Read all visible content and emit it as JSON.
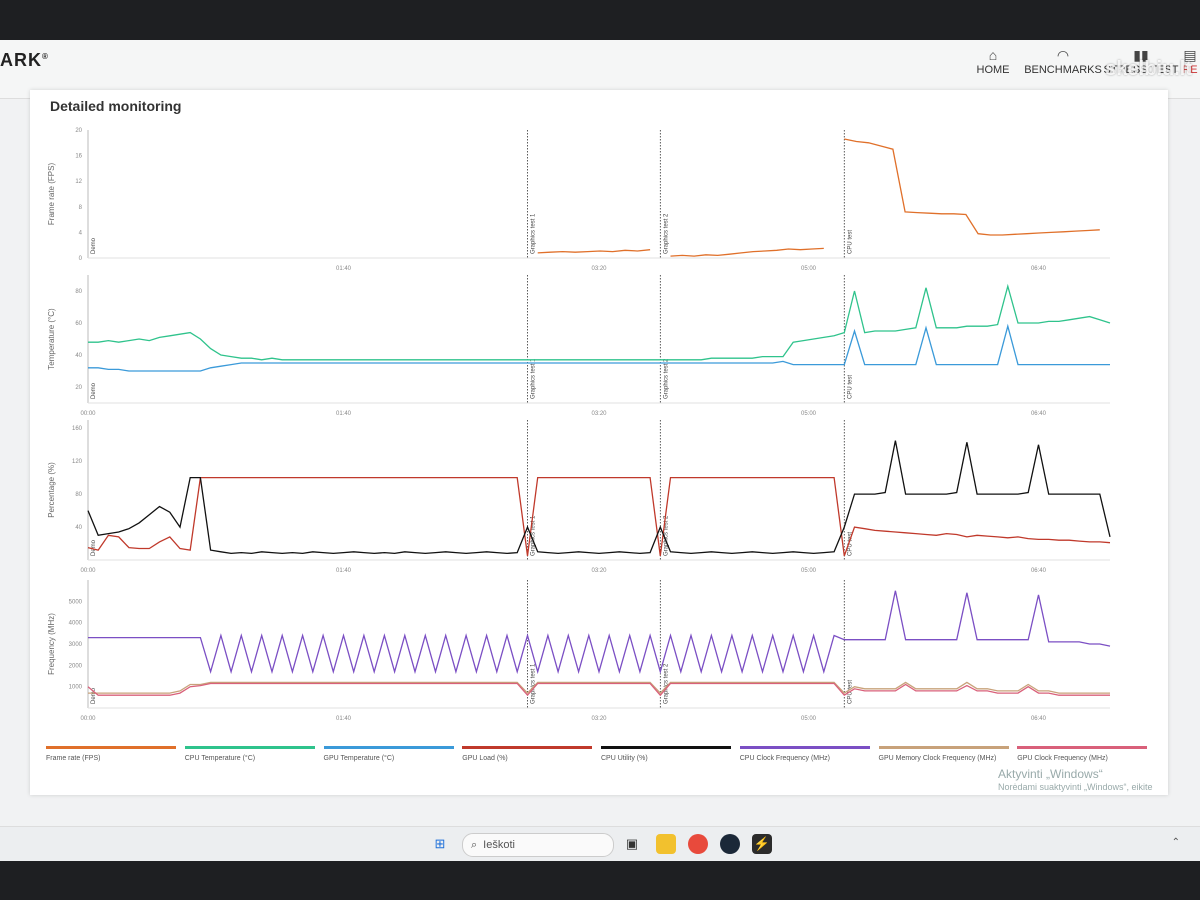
{
  "header": {
    "brand": "ARK",
    "nav": [
      {
        "label": "HOME",
        "icon": "home-icon"
      },
      {
        "label": "BENCHMARKS",
        "icon": "speedometer-icon"
      },
      {
        "label": "STRESS TEST",
        "icon": "chart-icon"
      },
      {
        "label": "RE",
        "icon": "results-icon"
      }
    ],
    "watermark": "skelbiu.lt"
  },
  "panel": {
    "title": "Detailed monitoring"
  },
  "colors": {
    "frame_rate": "#e0702a",
    "cpu_temp": "#2fc38c",
    "gpu_temp": "#3b9ad9",
    "gpu_load": "#c0392b",
    "cpu_utility": "#111111",
    "cpu_clock": "#7b4fc4",
    "gpu_mem_clock": "#c8a27a",
    "gpu_clock": "#d9607a"
  },
  "chart_data": [
    {
      "type": "line",
      "ylabel": "Frame rate (FPS)",
      "yticks": [
        "0",
        "4",
        "8",
        "12",
        "16",
        "20"
      ],
      "ylim": [
        0,
        20
      ],
      "xticks": [
        "01:40",
        "03:20",
        "05:00",
        "06:40"
      ],
      "markers": [
        {
          "label": "Demo",
          "t": 0
        },
        {
          "label": "Graphics test 1",
          "t": 0.43
        },
        {
          "label": "Graphics test 2",
          "t": 0.56
        },
        {
          "label": "CPU test",
          "t": 0.74
        }
      ],
      "series": [
        {
          "name": "Frame rate (FPS)",
          "color_key": "frame_rate",
          "segments": [
            {
              "t0": 0.44,
              "t1": 0.55,
              "values": [
                0.8,
                0.9,
                1.0,
                0.9,
                1.0,
                1.1,
                1.0,
                1.2,
                1.1,
                1.3
              ]
            },
            {
              "t0": 0.57,
              "t1": 0.72,
              "values": [
                0.3,
                0.4,
                0.3,
                0.5,
                0.4,
                0.6,
                0.8,
                1.0,
                1.1,
                1.2,
                1.4,
                1.3,
                1.4,
                1.5
              ]
            },
            {
              "t0": 0.74,
              "t1": 0.99,
              "values": [
                18.6,
                18.2,
                18.0,
                17.5,
                17.0,
                7.2,
                7.1,
                7.0,
                6.9,
                6.9,
                6.8,
                3.8,
                3.6,
                3.6,
                3.7,
                3.8,
                3.9,
                4.0,
                4.1,
                4.2,
                4.3,
                4.4
              ]
            }
          ]
        }
      ]
    },
    {
      "type": "line",
      "ylabel": "Temperature (°C)",
      "yticks": [
        "20",
        "40",
        "60",
        "80"
      ],
      "ylim": [
        10,
        90
      ],
      "xticks": [
        "00:00",
        "01:40",
        "03:20",
        "05:00",
        "06:40"
      ],
      "markers": [
        {
          "label": "Demo",
          "t": 0
        },
        {
          "label": "Graphics test 1",
          "t": 0.43
        },
        {
          "label": "Graphics test 2",
          "t": 0.56
        },
        {
          "label": "CPU test",
          "t": 0.74
        }
      ],
      "series": [
        {
          "name": "CPU Temperature (°C)",
          "color_key": "cpu_temp",
          "values": [
            48,
            48,
            49,
            48,
            49,
            50,
            49,
            51,
            52,
            53,
            54,
            50,
            44,
            40,
            39,
            38,
            38,
            37,
            38,
            37,
            37,
            37,
            37,
            37,
            37,
            37,
            37,
            37,
            37,
            37,
            37,
            37,
            37,
            37,
            37,
            37,
            37,
            37,
            37,
            37,
            37,
            37,
            37,
            37,
            37,
            37,
            37,
            37,
            37,
            37,
            37,
            37,
            37,
            37,
            37,
            37,
            37,
            37,
            37,
            37,
            37,
            38,
            38,
            38,
            38,
            38,
            39,
            39,
            39,
            48,
            49,
            50,
            51,
            52,
            54,
            80,
            54,
            55,
            55,
            55,
            56,
            57,
            82,
            57,
            57,
            57,
            58,
            58,
            58,
            59,
            83,
            60,
            60,
            60,
            61,
            61,
            62,
            63,
            64,
            62,
            60
          ]
        },
        {
          "name": "GPU Temperature (°C)",
          "color_key": "gpu_temp",
          "values": [
            32,
            32,
            31,
            31,
            30,
            30,
            30,
            30,
            30,
            30,
            30,
            30,
            32,
            33,
            34,
            35,
            35,
            35,
            35,
            35,
            35,
            35,
            35,
            35,
            35,
            35,
            35,
            35,
            35,
            35,
            35,
            35,
            35,
            35,
            35,
            35,
            35,
            35,
            35,
            35,
            35,
            35,
            35,
            35,
            35,
            35,
            35,
            35,
            35,
            35,
            35,
            35,
            35,
            35,
            35,
            35,
            35,
            35,
            35,
            35,
            35,
            35,
            35,
            35,
            35,
            35,
            35,
            35,
            36,
            34,
            34,
            34,
            34,
            34,
            34,
            55,
            34,
            34,
            34,
            34,
            34,
            34,
            57,
            34,
            34,
            34,
            34,
            34,
            34,
            34,
            58,
            34,
            34,
            34,
            34,
            34,
            34,
            34,
            34,
            34,
            34
          ]
        }
      ]
    },
    {
      "type": "line",
      "ylabel": "Percentage (%)",
      "yticks": [
        "40",
        "80",
        "120",
        "160"
      ],
      "ylim": [
        0,
        170
      ],
      "xticks": [
        "00:00",
        "01:40",
        "03:20",
        "05:00",
        "06:40"
      ],
      "markers": [
        {
          "label": "Demo",
          "t": 0
        },
        {
          "label": "Graphics test 1",
          "t": 0.43
        },
        {
          "label": "Graphics test 2",
          "t": 0.56
        },
        {
          "label": "CPU test",
          "t": 0.74
        }
      ],
      "series": [
        {
          "name": "GPU Load (%)",
          "color_key": "gpu_load",
          "values": [
            15,
            12,
            30,
            28,
            15,
            14,
            14,
            22,
            28,
            14,
            12,
            100,
            100,
            100,
            100,
            100,
            100,
            100,
            100,
            100,
            100,
            100,
            100,
            100,
            100,
            100,
            100,
            100,
            100,
            100,
            100,
            100,
            100,
            100,
            100,
            100,
            100,
            100,
            100,
            100,
            100,
            100,
            100,
            5,
            100,
            100,
            100,
            100,
            100,
            100,
            100,
            100,
            100,
            100,
            100,
            100,
            5,
            100,
            100,
            100,
            100,
            100,
            100,
            100,
            100,
            100,
            100,
            100,
            100,
            100,
            100,
            100,
            100,
            100,
            5,
            40,
            38,
            36,
            35,
            34,
            33,
            32,
            31,
            30,
            32,
            31,
            28,
            30,
            29,
            28,
            27,
            28,
            26,
            25,
            25,
            24,
            24,
            23,
            22,
            22,
            21
          ]
        },
        {
          "name": "CPU Utility (%)",
          "color_key": "cpu_utility",
          "values": [
            60,
            30,
            32,
            34,
            38,
            45,
            55,
            65,
            58,
            40,
            100,
            100,
            12,
            10,
            8,
            9,
            8,
            10,
            9,
            8,
            9,
            8,
            10,
            9,
            8,
            9,
            10,
            9,
            8,
            9,
            8,
            10,
            9,
            8,
            9,
            10,
            9,
            8,
            9,
            10,
            9,
            8,
            9,
            40,
            10,
            9,
            8,
            9,
            10,
            9,
            8,
            9,
            10,
            9,
            8,
            9,
            40,
            10,
            9,
            8,
            9,
            10,
            9,
            8,
            9,
            10,
            9,
            8,
            9,
            10,
            9,
            8,
            9,
            10,
            40,
            80,
            80,
            80,
            82,
            145,
            80,
            80,
            80,
            80,
            80,
            82,
            143,
            80,
            80,
            80,
            80,
            80,
            82,
            140,
            80,
            80,
            80,
            80,
            80,
            80,
            28
          ]
        }
      ]
    },
    {
      "type": "line",
      "ylabel": "Frequency (MHz)",
      "yticks": [
        "1000",
        "2000",
        "3000",
        "4000",
        "5000"
      ],
      "ylim": [
        0,
        6000
      ],
      "xticks": [
        "00:00",
        "01:40",
        "03:20",
        "05:00",
        "06:40"
      ],
      "markers": [
        {
          "label": "Demo",
          "t": 0
        },
        {
          "label": "Graphics test 1",
          "t": 0.43
        },
        {
          "label": "Graphics test 2",
          "t": 0.56
        },
        {
          "label": "CPU test",
          "t": 0.74
        }
      ],
      "series": [
        {
          "name": "CPU Clock Frequency (MHz)",
          "color_key": "cpu_clock",
          "values": [
            3300,
            3300,
            3300,
            3300,
            3300,
            3300,
            3300,
            3300,
            3300,
            3300,
            3300,
            3300,
            1700,
            3400,
            1700,
            3400,
            1700,
            3400,
            1700,
            3400,
            1700,
            3400,
            1700,
            3400,
            1700,
            3400,
            1700,
            3400,
            1700,
            3400,
            1700,
            3400,
            1700,
            3400,
            1700,
            3400,
            1700,
            3400,
            1700,
            3400,
            1700,
            3400,
            1700,
            3400,
            1700,
            3400,
            1700,
            3400,
            1700,
            3400,
            1700,
            3400,
            1700,
            3400,
            1700,
            3400,
            1700,
            3400,
            1700,
            3400,
            1700,
            3400,
            1700,
            3400,
            1700,
            3400,
            1700,
            3400,
            1700,
            3400,
            1700,
            3400,
            1700,
            3400,
            3200,
            3200,
            3200,
            3200,
            3200,
            5500,
            3200,
            3200,
            3200,
            3200,
            3200,
            3200,
            5400,
            3200,
            3200,
            3200,
            3200,
            3200,
            3200,
            5300,
            3100,
            3100,
            3100,
            3100,
            3000,
            3000,
            2900
          ]
        },
        {
          "name": "GPU Memory Clock Frequency (MHz)",
          "color_key": "gpu_mem_clock",
          "values": [
            700,
            700,
            700,
            700,
            700,
            700,
            700,
            700,
            700,
            800,
            1100,
            1100,
            1200,
            1200,
            1200,
            1200,
            1200,
            1200,
            1200,
            1200,
            1200,
            1200,
            1200,
            1200,
            1200,
            1200,
            1200,
            1200,
            1200,
            1200,
            1200,
            1200,
            1200,
            1200,
            1200,
            1200,
            1200,
            1200,
            1200,
            1200,
            1200,
            1200,
            1200,
            700,
            1200,
            1200,
            1200,
            1200,
            1200,
            1200,
            1200,
            1200,
            1200,
            1200,
            1200,
            1200,
            700,
            1200,
            1200,
            1200,
            1200,
            1200,
            1200,
            1200,
            1200,
            1200,
            1200,
            1200,
            1200,
            1200,
            1200,
            1200,
            1200,
            1200,
            700,
            1000,
            900,
            900,
            900,
            900,
            1200,
            900,
            900,
            900,
            900,
            900,
            1200,
            900,
            900,
            800,
            800,
            800,
            1100,
            800,
            800,
            700,
            700,
            700,
            700,
            700,
            700
          ]
        },
        {
          "name": "GPU Clock Frequency (MHz)",
          "color_key": "gpu_clock",
          "values": [
            1000,
            600,
            600,
            600,
            600,
            600,
            600,
            600,
            600,
            700,
            1000,
            1050,
            1150,
            1150,
            1150,
            1150,
            1150,
            1150,
            1150,
            1150,
            1150,
            1150,
            1150,
            1150,
            1150,
            1150,
            1150,
            1150,
            1150,
            1150,
            1150,
            1150,
            1150,
            1150,
            1150,
            1150,
            1150,
            1150,
            1150,
            1150,
            1150,
            1150,
            1150,
            600,
            1150,
            1150,
            1150,
            1150,
            1150,
            1150,
            1150,
            1150,
            1150,
            1150,
            1150,
            1150,
            600,
            1150,
            1150,
            1150,
            1150,
            1150,
            1150,
            1150,
            1150,
            1150,
            1150,
            1150,
            1150,
            1150,
            1150,
            1150,
            1150,
            1150,
            600,
            900,
            800,
            800,
            800,
            800,
            1100,
            800,
            800,
            800,
            800,
            800,
            1050,
            800,
            800,
            700,
            700,
            700,
            1000,
            700,
            700,
            600,
            600,
            600,
            600,
            600,
            600
          ]
        }
      ]
    }
  ],
  "legend": [
    {
      "label": "Frame rate (FPS)",
      "color_key": "frame_rate"
    },
    {
      "label": "CPU Temperature (°C)",
      "color_key": "cpu_temp"
    },
    {
      "label": "GPU Temperature (°C)",
      "color_key": "gpu_temp"
    },
    {
      "label": "GPU Load (%)",
      "color_key": "gpu_load"
    },
    {
      "label": "CPU Utility (%)",
      "color_key": "cpu_utility"
    },
    {
      "label": "CPU Clock Frequency (MHz)",
      "color_key": "cpu_clock"
    },
    {
      "label": "GPU Memory Clock Frequency (MHz)",
      "color_key": "gpu_mem_clock"
    },
    {
      "label": "GPU Clock Frequency (MHz)",
      "color_key": "gpu_clock"
    }
  ],
  "windows_activation": {
    "line1": "Aktyvinti „Windows“",
    "line2": "Norėdami suaktyvinti „Windows“, eikite"
  },
  "taskbar": {
    "search_placeholder": "Ieškoti",
    "icons": [
      "windows-start-icon",
      "search-icon",
      "task-view-icon",
      "file-explorer-icon",
      "chrome-icon",
      "steam-icon",
      "app-icon"
    ]
  }
}
